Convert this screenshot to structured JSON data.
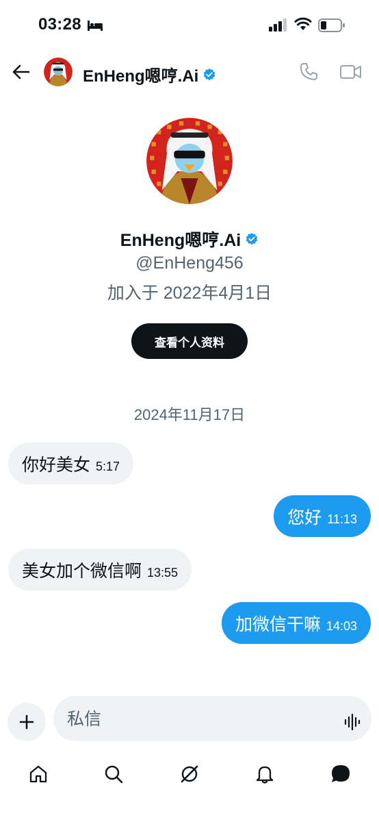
{
  "status_bar": {
    "time": "03:28",
    "icons": [
      "bed-icon",
      "signal-icon",
      "wifi-icon",
      "battery-icon"
    ]
  },
  "header": {
    "back_icon": "back-arrow-icon",
    "name": "EnHeng嗯哼.Ai",
    "verified": true,
    "actions": [
      "phone-icon",
      "video-icon"
    ]
  },
  "profile": {
    "name": "EnHeng嗯哼.Ai",
    "handle": "@EnHeng456",
    "joined": "加入于 2022年4月1日",
    "view_profile_label": "查看个人资料"
  },
  "conversation": {
    "date": "2024年11月17日",
    "messages": [
      {
        "direction": "in",
        "text": "你好美女",
        "time": "5:17"
      },
      {
        "direction": "out",
        "text": "您好",
        "time": "11:13"
      },
      {
        "direction": "in",
        "text": "美女加个微信啊",
        "time": "13:55"
      },
      {
        "direction": "out",
        "text": "加微信干嘛",
        "time": "14:03"
      }
    ]
  },
  "composer": {
    "placeholder": "私信",
    "add_icon": "plus-icon",
    "voice_icon": "voice-wave-icon"
  },
  "bottom_nav": {
    "items": [
      "home-icon",
      "search-icon",
      "grok-icon",
      "notifications-icon",
      "messages-icon"
    ],
    "active": "messages-icon"
  },
  "colors": {
    "accent": "#1d9bf0",
    "bubble_in": "#eff3f4",
    "text_primary": "#0f1419",
    "text_secondary": "#536471",
    "avatar_red": "#d2231d"
  }
}
